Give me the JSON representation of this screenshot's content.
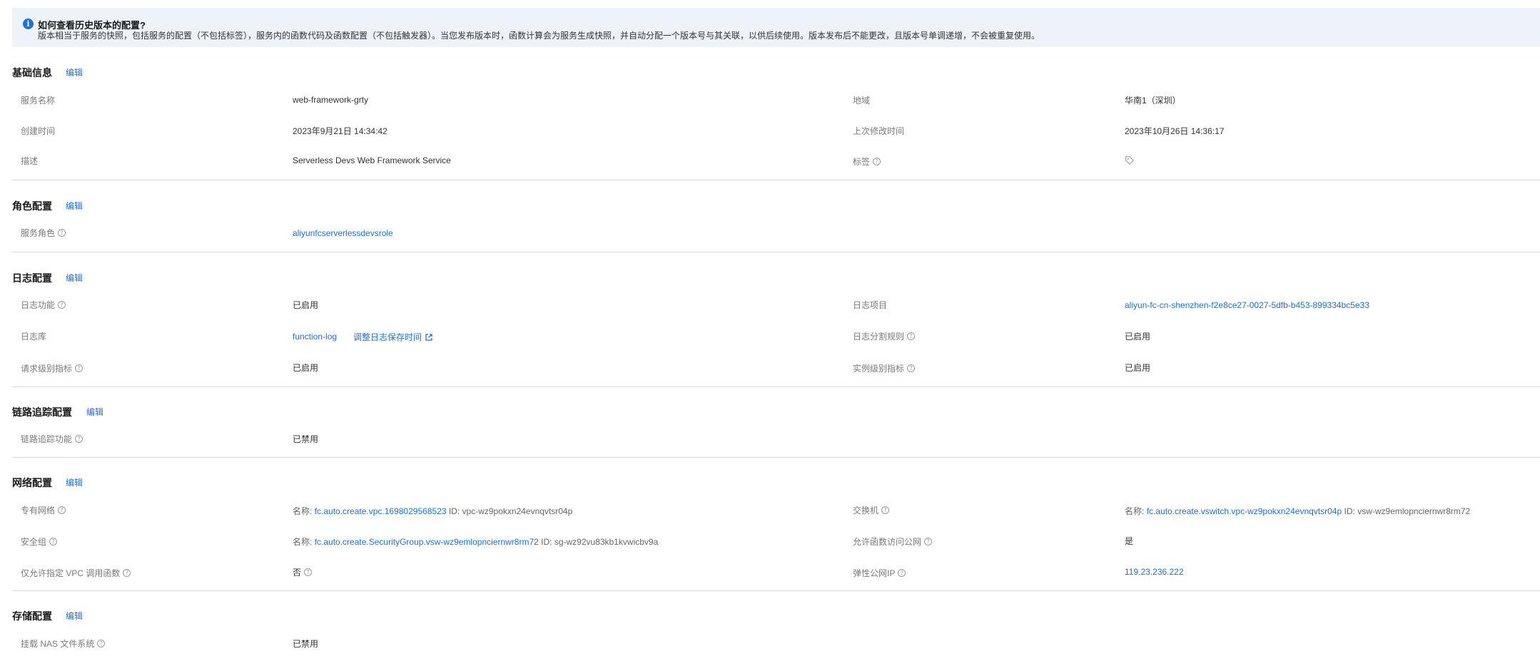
{
  "notice": {
    "icon": "info-icon",
    "title": "如何查看历史版本的配置?",
    "text": "版本相当于服务的快照，包括服务的配置（不包括标签），服务内的函数代码及函数配置（不包括触发器）。当您发布版本时，函数计算会为服务生成快照，并自动分配一个版本号与其关联，以供后续使用。版本发布后不能更改，且版本号单调递增，不会被重复使用。"
  },
  "edit_label": "编辑",
  "basic": {
    "title": "基础信息",
    "service_name_label": "服务名称",
    "service_name": "web-framework-grty",
    "region_label": "地域",
    "region": "华南1（深圳）",
    "created_label": "创建时间",
    "created": "2023年9月21日 14:34:42",
    "modified_label": "上次修改时间",
    "modified": "2023年10月26日 14:36:17",
    "desc_label": "描述",
    "desc": "Serverless Devs Web Framework Service",
    "tags_label": "标签"
  },
  "role": {
    "title": "角色配置",
    "service_role_label": "服务角色",
    "service_role": "aliyunfcserverlessdevsrole"
  },
  "log": {
    "title": "日志配置",
    "log_feature_label": "日志功能",
    "log_feature": "已启用",
    "log_project_label": "日志项目",
    "log_project": "aliyun-fc-cn-shenzhen-f2e8ce27-0027-5dfb-b453-899334bc5e33",
    "logstore_label": "日志库",
    "logstore": "function-log",
    "adjust_retention": "调整日志保存时间",
    "split_rule_label": "日志分割规则",
    "split_rule": "已启用",
    "request_metrics_label": "请求级别指标",
    "request_metrics": "已启用",
    "instance_metrics_label": "实例级别指标",
    "instance_metrics": "已启用"
  },
  "tracing": {
    "title": "链路追踪配置",
    "feature_label": "链路追踪功能",
    "feature": "已禁用"
  },
  "network": {
    "title": "网络配置",
    "name_prefix": "名称:",
    "id_prefix": "ID:",
    "vpc_label": "专有网络",
    "vpc_name": "fc.auto.create.vpc.1698029568523",
    "vpc_id": "vpc-wz9pokxn24evnqvtsr04p",
    "vswitch_label": "交换机",
    "vswitch_name": "fc.auto.create.vswitch.vpc-wz9pokxn24evnqvtsr04p",
    "vswitch_id": "vsw-wz9emlopnciernwr8rm72",
    "sg_label": "安全组",
    "sg_name": "fc.auto.create.SecurityGroup.vsw-wz9emlopnciernwr8rm72",
    "sg_id": "sg-wz92vu83kb1kvwicbv9a",
    "public_access_label": "允许函数访问公网",
    "public_access": "是",
    "vpc_only_label": "仅允许指定 VPC 调用函数",
    "vpc_only": "否",
    "eip_label": "弹性公网IP",
    "eip": "119.23.236.222"
  },
  "storage": {
    "title": "存储配置",
    "nas_label": "挂载 NAS 文件系统",
    "nas": "已禁用"
  },
  "colors": {
    "link": "#1f6fd6",
    "notice_bg": "#eef3f9",
    "divider": "#d9d9d9"
  }
}
